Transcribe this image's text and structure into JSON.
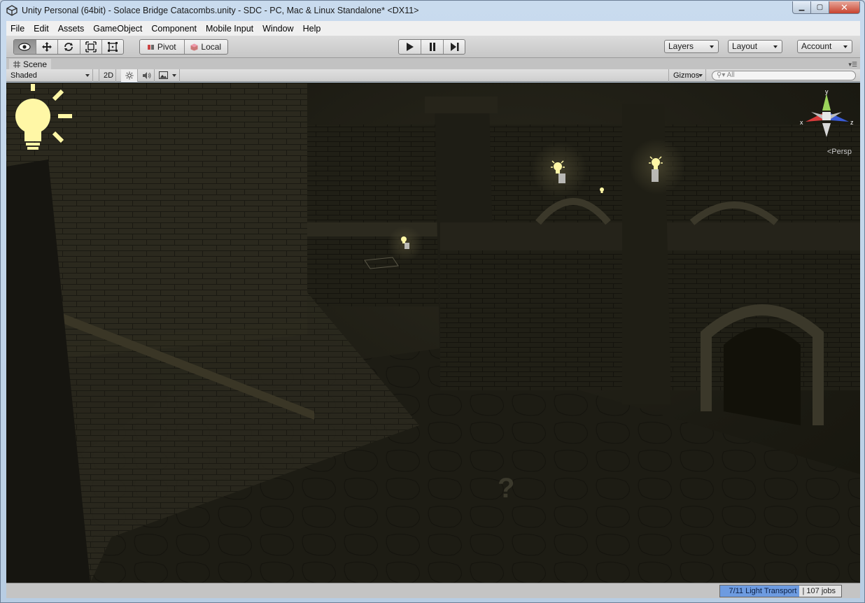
{
  "window": {
    "title": "Unity Personal (64bit) - Solace Bridge Catacombs.unity - SDC - PC, Mac & Linux Standalone* <DX11>",
    "minimize": "▁",
    "maximize": "▢",
    "close": "✕"
  },
  "menu": [
    "File",
    "Edit",
    "Assets",
    "GameObject",
    "Component",
    "Mobile Input",
    "Window",
    "Help"
  ],
  "toolbar": {
    "tools": [
      "hand-icon",
      "move-icon",
      "rotate-icon",
      "scale-icon",
      "rect-icon"
    ],
    "pivot_label": "Pivot",
    "local_label": "Local",
    "layers_label": "Layers",
    "layout_label": "Layout",
    "account_label": "Account"
  },
  "scene_tab": {
    "label": "Scene"
  },
  "scene_toolbar": {
    "shading_mode": "Shaded",
    "mode_2d": "2D",
    "gizmos_label": "Gizmos",
    "search_placeholder": "All"
  },
  "viewport": {
    "projection_label": "Persp",
    "axis_x": "x",
    "axis_y": "y",
    "axis_z": "z",
    "unknown_marker": "?"
  },
  "status": {
    "progress_text": "7/11 Light Transport",
    "jobs_text": "107 jobs",
    "progress_fraction": 0.636
  },
  "colors": {
    "play_accent": "#222222",
    "progress_fill": "#6d9be0",
    "light_gizmo": "#fff7a6"
  }
}
